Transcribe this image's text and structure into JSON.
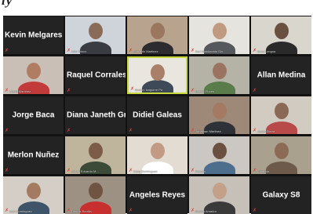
{
  "header": {
    "cut_text": "ly"
  },
  "participants": [
    {
      "name": "Kevin Melgares",
      "video": false
    },
    {
      "name": "Iulio Trinco",
      "video": true,
      "bg": "#cfd4da",
      "skin": "#8a6b57",
      "shirt": "#3b3b44"
    },
    {
      "name": "Eduardo Martinez",
      "video": true,
      "bg": "#b8a48e",
      "skin": "#9c7760",
      "shirt": "#2c2c30"
    },
    {
      "name": "Kari Maldonado Sin",
      "video": true,
      "bg": "#e6e4df",
      "skin": "#c09a80",
      "shirt": "#55585c"
    },
    {
      "name": "Dora Longoa",
      "video": true,
      "bg": "#d9d6ce",
      "skin": "#6a5040",
      "shirt": "#2a2a2a"
    },
    {
      "name": "Lizeth Martinez",
      "video": true,
      "bg": "#c9bfb6",
      "skin": "#b07c62",
      "shirt": "#c23a3a"
    },
    {
      "name": "Raquel Corrales",
      "video": false
    },
    {
      "name": "Nelson Izaguirre Pa",
      "video": true,
      "active": true,
      "bg": "#e9e6e0",
      "skin": "#a8806a",
      "shirt": "#3f4a58"
    },
    {
      "name": "Hector Flores",
      "video": true,
      "bg": "#b5b3a6",
      "skin": "#9a7461",
      "shirt": "#5a7b4a"
    },
    {
      "name": "Allan Medina",
      "video": false
    },
    {
      "name": "Jorge Baca",
      "video": false
    },
    {
      "name": "Diana Janeth Gr...",
      "video": false
    },
    {
      "name": "Didiel Galeas",
      "video": false
    },
    {
      "name": "Jonathan Martinez",
      "video": true,
      "bg": "#9e8878",
      "skin": "#a57a62",
      "shirt": "#2e3238"
    },
    {
      "name": "Jesse Sierra",
      "video": true,
      "bg": "#d2cbc2",
      "skin": "#8b6956",
      "shirt": "#b94a4a"
    },
    {
      "name": "Merlon Nuñez",
      "video": false
    },
    {
      "name": "Oscar Eduardo M...",
      "video": true,
      "bg": "#bfb59c",
      "skin": "#7c5c48",
      "shirt": "#3c4a38"
    },
    {
      "name": "Carly Dominguez",
      "video": true,
      "bg": "#e2dcd3",
      "skin": "#c39a84",
      "shirt": "#ffffff"
    },
    {
      "name": "Francis",
      "video": true,
      "bg": "#cbc7c2",
      "skin": "#6b4f40",
      "shirt": "#4d6e8c"
    },
    {
      "name": "Amanda",
      "video": true,
      "bg": "#a9a08e",
      "skin": "#8d6a55",
      "shirt": "#6e5a4a"
    },
    {
      "name": "Ivan Dominguez",
      "video": true,
      "bg": "#d4cec6",
      "skin": "#a47b60",
      "shirt": "#3e5468"
    },
    {
      "name": "Dennis Bonilla",
      "video": true,
      "bg": "#9d9184",
      "skin": "#6f5442",
      "shirt": "#c8302f"
    },
    {
      "name": "Angeles Reyes",
      "video": false
    },
    {
      "name": "Norma Amador",
      "video": true,
      "bg": "#c6c0b8",
      "skin": "#c5a088",
      "shirt": "#3a3a3a"
    },
    {
      "name": "Galaxy S8",
      "video": false
    }
  ]
}
